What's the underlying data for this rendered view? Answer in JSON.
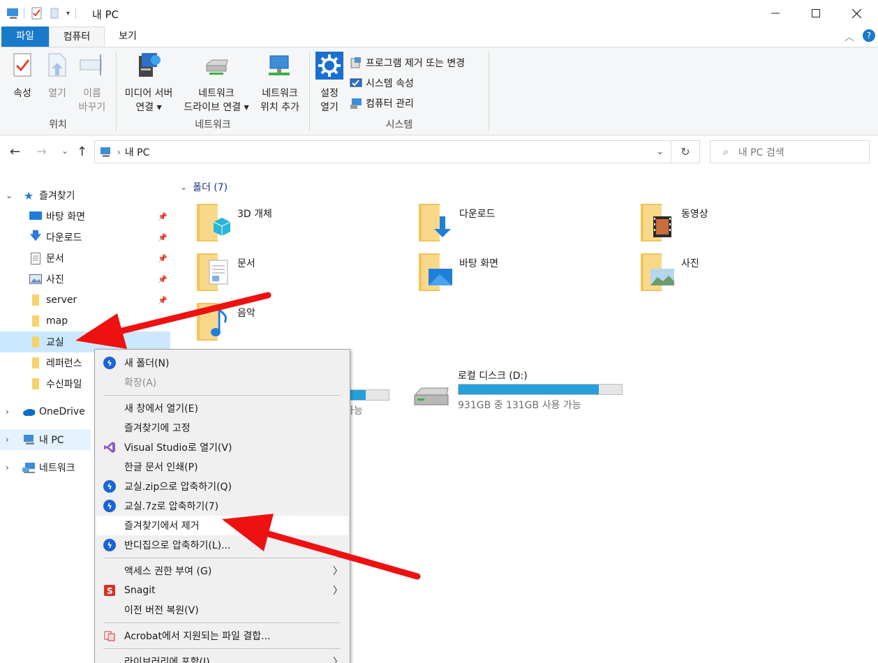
{
  "window": {
    "title": "내 PC",
    "minimize_icon": "minimize-icon",
    "maximize_icon": "maximize-icon",
    "close_icon": "close-icon"
  },
  "ribbon_tabs": {
    "file": "파일",
    "computer": "컴퓨터",
    "view": "보기"
  },
  "ribbon": {
    "location_group": {
      "label": "위치",
      "properties": "속성",
      "open": "열기",
      "rename_line1": "이름",
      "rename_line2": "바꾸기"
    },
    "network_group": {
      "label": "네트워크",
      "media_line1": "미디어 서버",
      "media_line2": "연결 ▾",
      "map_drive_line1": "네트워크",
      "map_drive_line2": "드라이브 연결 ▾",
      "add_location_line1": "네트워크",
      "add_location_line2": "위치 추가"
    },
    "system_group": {
      "label": "시스템",
      "settings_line1": "설정",
      "settings_line2": "열기",
      "uninstall": "프로그램 제거 또는 변경",
      "system_props": "시스템 속성",
      "manage": "컴퓨터 관리"
    }
  },
  "address": {
    "crumb": "내 PC",
    "search_placeholder": "내 PC 검색"
  },
  "nav": {
    "quick_access": "즐겨찾기",
    "items": [
      {
        "label": "바탕 화면"
      },
      {
        "label": "다운로드"
      },
      {
        "label": "문서"
      },
      {
        "label": "사진"
      },
      {
        "label": "server"
      },
      {
        "label": "map"
      },
      {
        "label": "교실"
      },
      {
        "label": "레퍼런스"
      },
      {
        "label": "수신파일"
      }
    ],
    "onedrive": "OneDrive",
    "this_pc": "내 PC",
    "network": "네트워크"
  },
  "content": {
    "folders_header": "폴더 (7)",
    "folders": [
      {
        "name": "3D 개체"
      },
      {
        "name": "다운로드"
      },
      {
        "name": "동영상"
      },
      {
        "name": "문서"
      },
      {
        "name": "바탕 화면"
      },
      {
        "name": "사진"
      },
      {
        "name": "음악"
      }
    ],
    "drives": [
      {
        "name": "",
        "free": "가능",
        "used_fraction": 0.86
      },
      {
        "name": "로컬 디스크 (D:)",
        "free": "931GB 중 131GB 사용 가능",
        "used_fraction": 0.86
      }
    ]
  },
  "context_menu": {
    "items": [
      {
        "label": "새 폴더(N)"
      },
      {
        "label": "확장(A)"
      },
      {
        "label": "새 창에서 열기(E)"
      },
      {
        "label": "즐겨찾기에 고정"
      },
      {
        "label": "Visual Studio로 열기(V)"
      },
      {
        "label": "한글 문서 인쇄(P)"
      },
      {
        "label": "교실.zip으로 압축하기(Q)"
      },
      {
        "label": "교실.7z로 압축하기(7)"
      },
      {
        "label": "즐겨찾기에서 제거"
      },
      {
        "label": "반디집으로 압축하기(L)..."
      },
      {
        "label": "액세스 권한 부여 (G)"
      },
      {
        "label": "Snagit"
      },
      {
        "label": "이전 버전 복원(V)"
      },
      {
        "label": "Acrobat에서 지원되는 파일 결합..."
      },
      {
        "label": "라이브러리에 포함(I)"
      }
    ]
  },
  "colors": {
    "accent": "#1979ca",
    "selection": "#cce8ff",
    "drive_bar": "#26a0da",
    "annotation_arrow": "#ee1111"
  }
}
